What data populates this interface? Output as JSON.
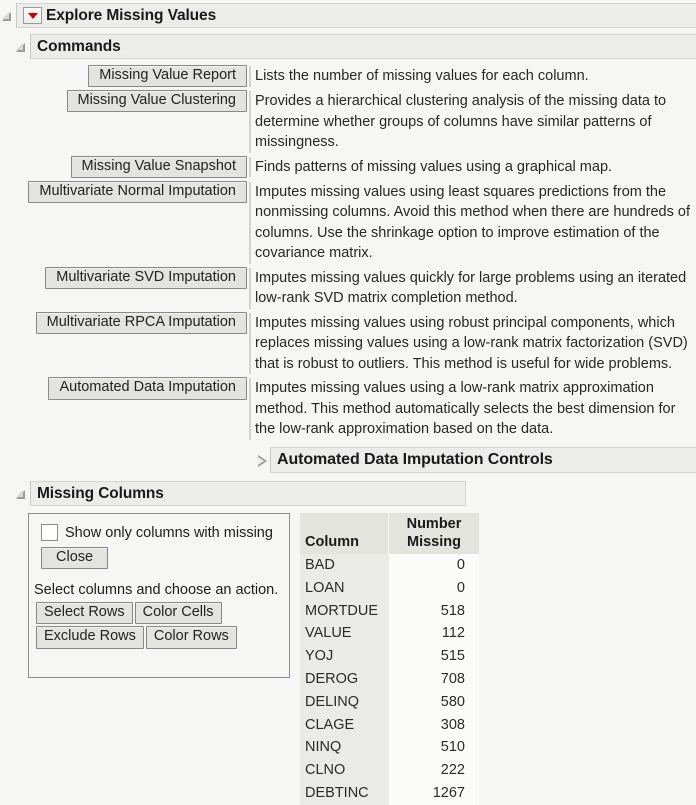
{
  "window": {
    "title": "Explore Missing Values",
    "menu_icon": "red-triangle-menu-icon",
    "disclosure_open_icon": "disclosure-open-icon",
    "disclosure_closed_icon": "disclosure-closed-icon"
  },
  "commands": {
    "header": "Commands",
    "items": [
      {
        "label": "Missing Value Report",
        "description": "Lists the number of missing values for each column."
      },
      {
        "label": "Missing Value Clustering",
        "description": "Provides a hierarchical clustering analysis of the missing data to determine whether groups of columns have similar patterns of missingness."
      },
      {
        "label": "Missing Value Snapshot",
        "description": "Finds patterns of missing values using a graphical map."
      },
      {
        "label": "Multivariate Normal Imputation",
        "description": "Imputes missing values using least squares predictions from the nonmissing columns. Avoid this method when there are hundreds of columns. Use the shrinkage option to improve estimation of the covariance matrix."
      },
      {
        "label": "Multivariate SVD Imputation",
        "description": "Imputes missing values quickly for large problems using an iterated low-rank SVD matrix completion method."
      },
      {
        "label": "Multivariate RPCA Imputation",
        "description": "Imputes missing values using robust principal components, which replaces missing values using a low-rank matrix factorization (SVD) that is robust to outliers. This method is useful for wide problems."
      },
      {
        "label": "Automated Data Imputation",
        "description": "Imputes missing values using a low-rank matrix approximation method. This method automatically selects the best dimension for the low-rank approximation based on the data."
      }
    ]
  },
  "adi_controls": {
    "header": "Automated Data Imputation Controls"
  },
  "missing_columns": {
    "header": "Missing Columns",
    "show_only_missing_label": "Show only columns with missing",
    "show_only_missing_checked": false,
    "close_label": "Close",
    "hint": "Select columns and choose an action.",
    "actions": [
      [
        "Select Rows",
        "Color Cells"
      ],
      [
        "Exclude Rows",
        "Color Rows"
      ]
    ],
    "table": {
      "headers": [
        "Column",
        "Number Missing"
      ],
      "header_line1": [
        "",
        "Number"
      ],
      "header_line2": [
        "Column",
        "Missing"
      ],
      "rows": [
        {
          "column": "BAD",
          "number_missing": "0"
        },
        {
          "column": "LOAN",
          "number_missing": "0"
        },
        {
          "column": "MORTDUE",
          "number_missing": "518"
        },
        {
          "column": "VALUE",
          "number_missing": "112"
        },
        {
          "column": "YOJ",
          "number_missing": "515"
        },
        {
          "column": "DEROG",
          "number_missing": "708"
        },
        {
          "column": "DELINQ",
          "number_missing": "580"
        },
        {
          "column": "CLAGE",
          "number_missing": "308"
        },
        {
          "column": "NINQ",
          "number_missing": "510"
        },
        {
          "column": "CLNO",
          "number_missing": "222"
        },
        {
          "column": "DEBTINC",
          "number_missing": "1267"
        }
      ]
    }
  },
  "colors": {
    "menu_triangle": "#d00000",
    "header_bar": "#ececeb",
    "page_background": "#f6f6f4",
    "table_header": "#e4e4df",
    "table_name_cell": "#eaeae6"
  }
}
